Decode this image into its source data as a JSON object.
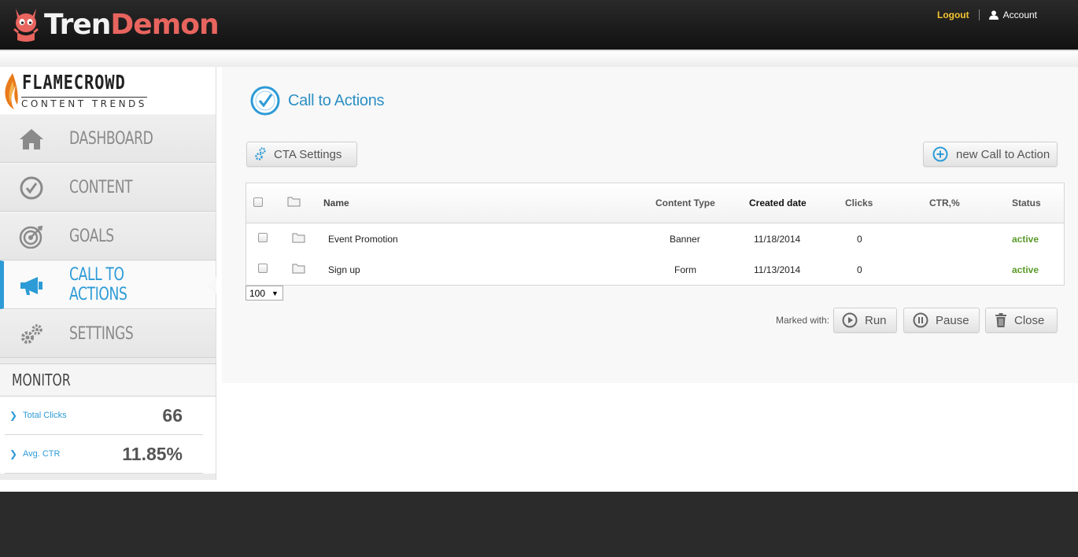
{
  "header": {
    "brand_part1": "Tren",
    "brand_part2": "Demon",
    "logout_label": "Logout",
    "account_label": "Account"
  },
  "sidebar": {
    "client_name": "FLAMECROWD",
    "client_tagline": "CONTENT TRENDS",
    "items": [
      {
        "label": "DASHBOARD",
        "icon": "home-icon"
      },
      {
        "label": "CONTENT",
        "icon": "check-circle-icon"
      },
      {
        "label": "GOALS",
        "icon": "target-icon"
      },
      {
        "label": "CALL TO ACTIONS",
        "icon": "megaphone-icon",
        "active": true
      },
      {
        "label": "SETTINGS",
        "icon": "gears-icon"
      }
    ],
    "monitor": {
      "title": "MONITOR",
      "stats": [
        {
          "label": "Total Clicks",
          "value": "66"
        },
        {
          "label": "Avg. CTR",
          "value": "11.85%"
        }
      ]
    }
  },
  "main": {
    "title": "Call to Actions",
    "cta_settings_label": "CTA Settings",
    "new_cta_label": "new Call to Action",
    "table": {
      "columns": [
        "Name",
        "Content Type",
        "Created date",
        "Clicks",
        "CTR,%",
        "Status"
      ],
      "rows": [
        {
          "name": "Event Promotion",
          "content_type": "Banner",
          "created": "11/18/2014",
          "clicks": "0",
          "ctr": "",
          "status": "active"
        },
        {
          "name": "Sign up",
          "content_type": "Form",
          "created": "11/13/2014",
          "clicks": "0",
          "ctr": "",
          "status": "active"
        }
      ]
    },
    "per_page": "100",
    "marked_with_label": "Marked with:",
    "run_label": "Run",
    "pause_label": "Pause",
    "close_label": "Close"
  },
  "colors": {
    "accent": "#2d9bd6",
    "status_active": "#5a9a2a",
    "logout": "#f4c430",
    "brand_red": "#e8645e"
  }
}
